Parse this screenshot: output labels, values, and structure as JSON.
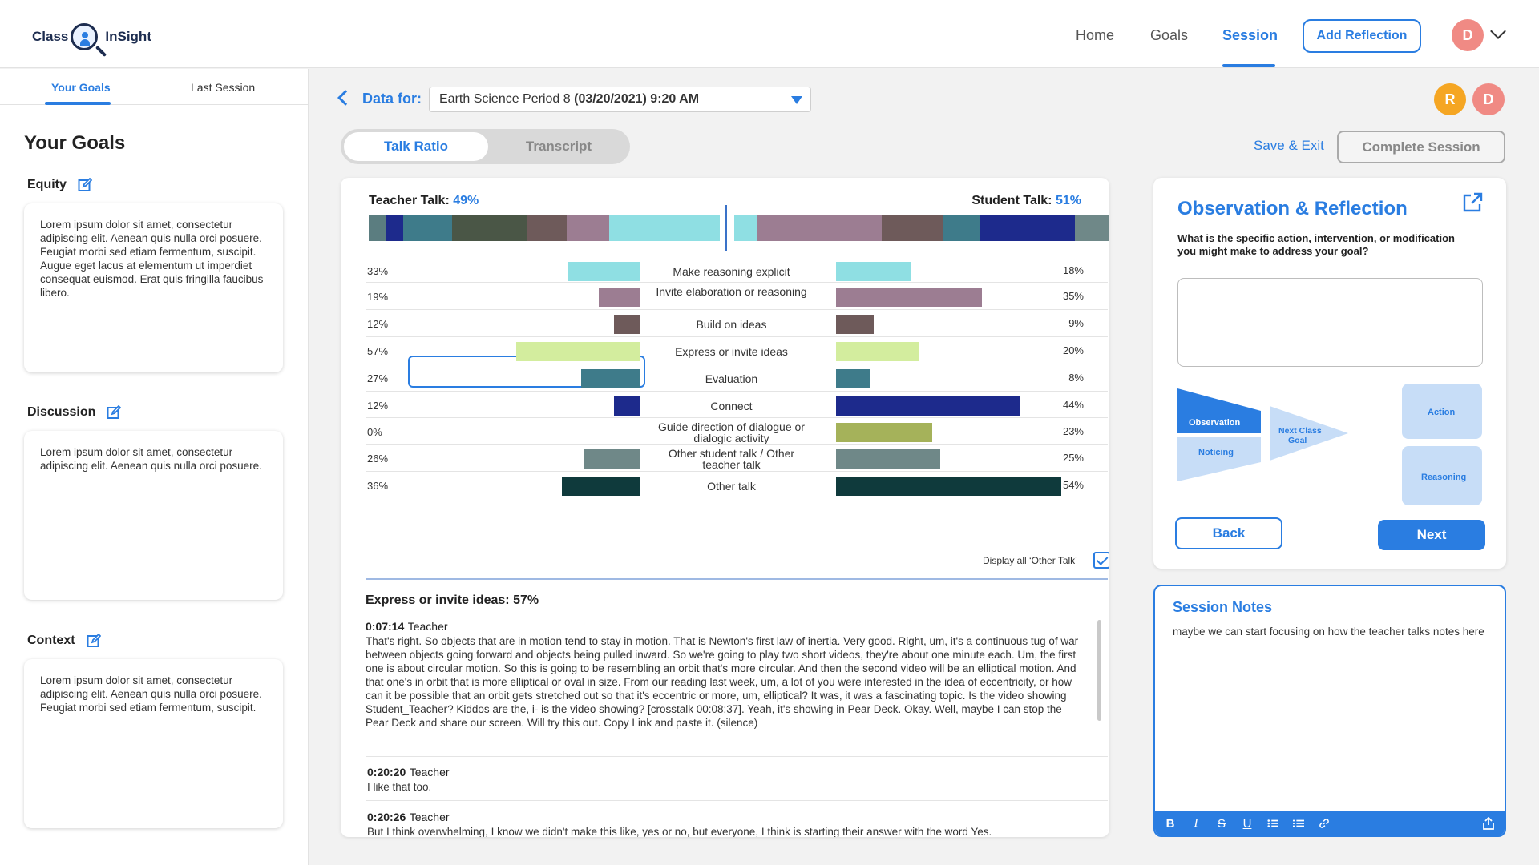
{
  "header": {
    "logo_left": "Class",
    "logo_right": "InSight",
    "nav": [
      {
        "label": "Home"
      },
      {
        "label": "Goals"
      },
      {
        "label": "Session"
      }
    ],
    "add_reflection": "Add Reflection",
    "user_initial": "D"
  },
  "sidebar": {
    "tabs": [
      {
        "label": "Your Goals"
      },
      {
        "label": "Last Session"
      }
    ],
    "title": "Your Goals",
    "goals": [
      {
        "label": "Equity",
        "text": "Lorem ipsum dolor sit amet, consectetur adipiscing elit. Aenean quis nulla orci posuere. Feugiat morbi sed etiam fermentum, suscipit. Augue eget lacus at elementum ut imperdiet consequat euismod. Erat quis fringilla faucibus libero."
      },
      {
        "label": "Discussion",
        "text": "Lorem ipsum dolor sit amet, consectetur adipiscing elit. Aenean quis nulla orci posuere."
      },
      {
        "label": "Context",
        "text": "Lorem ipsum dolor sit amet, consectetur adipiscing elit. Aenean quis nulla orci posuere. Feugiat morbi sed etiam fermentum, suscipit."
      }
    ]
  },
  "session": {
    "data_for_label": "Data for:",
    "select_name": "Earth Science Period 8",
    "select_date": "(03/20/2021) 9:20 AM",
    "participants": [
      {
        "initial": "R",
        "color": "#f5a623"
      },
      {
        "initial": "D",
        "color": "#f08a84"
      }
    ],
    "tabs": {
      "talk_ratio": "Talk Ratio",
      "transcript": "Transcript"
    },
    "save_exit": "Save & Exit",
    "complete": "Complete Session"
  },
  "talk": {
    "teacher_label": "Teacher Talk:",
    "teacher_pct": "49%",
    "student_label": "Student Talk:",
    "student_pct": "51%",
    "teacher_stack": [
      {
        "color": "#5b7d80",
        "value": 18
      },
      {
        "color": "#1d2a8c",
        "value": 17
      },
      {
        "color": "#3e7b8a",
        "value": 50
      },
      {
        "color": "#4a5646",
        "value": 76
      },
      {
        "color": "#6e5a5a",
        "value": 41
      },
      {
        "color": "#9c7d92",
        "value": 43
      },
      {
        "color": "#8fdfe3",
        "value": 113
      }
    ],
    "student_stack": [
      {
        "color": "#8fdfe3",
        "value": 28
      },
      {
        "color": "#9c7d92",
        "value": 155
      },
      {
        "color": "#6e5a5a",
        "value": 76
      },
      {
        "color": "#3e7b8a",
        "value": 46
      },
      {
        "color": "#1d2a8c",
        "value": 117
      },
      {
        "color": "#6f8888",
        "value": 42
      }
    ],
    "rows": [
      {
        "label": "Make reasoning explicit",
        "teacher": "33%",
        "student": "18%",
        "t": 33,
        "s": 18,
        "color": "#8fdfe3"
      },
      {
        "label": "Invite elaboration or reasoning",
        "teacher": "19%",
        "student": "35%",
        "t": 19,
        "s": 35,
        "color": "#9c7d92"
      },
      {
        "label": "Build on ideas",
        "teacher": "12%",
        "student": "9%",
        "t": 12,
        "s": 9,
        "color": "#6e5a5a"
      },
      {
        "label": "Express or invite ideas",
        "teacher": "57%",
        "student": "20%",
        "t": 57,
        "s": 20,
        "color": "#d3ed9e"
      },
      {
        "label": "Evaluation",
        "teacher": "27%",
        "student": "8%",
        "t": 27,
        "s": 8,
        "color": "#3e7b8a"
      },
      {
        "label": "Connect",
        "teacher": "12%",
        "student": "44%",
        "t": 12,
        "s": 44,
        "color": "#1d2a8c"
      },
      {
        "label": "Guide direction of dialogue or dialogic activity",
        "teacher": "0%",
        "student": "23%",
        "t": 0,
        "s": 23,
        "color": "#a5b25a"
      },
      {
        "label": "Other student talk / Other teacher talk",
        "teacher": "26%",
        "student": "25%",
        "t": 26,
        "s": 25,
        "color": "#6f8888"
      },
      {
        "label": "Other talk",
        "teacher": "36%",
        "student": "54%",
        "t": 36,
        "s": 54,
        "color": "#0f3a3c"
      }
    ],
    "display_other": "Display all ‘Other Talk’",
    "section_title": "Express or invite ideas: 57%",
    "transcript": [
      {
        "time": "0:07:14",
        "speaker": "Teacher",
        "text": "That's right. So objects that are in motion tend to stay in motion. That is Newton's first law of inertia. Very good. Right, um, it's a continuous tug of war between objects going forward and objects being pulled inward. So we're going to play two short videos, they're about one minute each. Um, the first one is about circular motion. So this is going to be resembling an orbit that's more circular. And then the second video will be an elliptical motion. And that one's in orbit that is more elliptical or oval in size. From our reading last week, um, a lot of you were interested in the idea of eccentricity, or how can it be possible that an orbit gets stretched out so that it's eccentric or more, um, elliptical? It was, it was a fascinating topic. Is the video showing Student_Teacher? Kiddos are the, i- is the video showing? [crosstalk 00:08:37]. Yeah, it's showing in Pear Deck. Okay. Well, maybe I can stop the Pear Deck and share our screen. Will try this out. Copy Link and paste it. (silence)"
      },
      {
        "time": "0:20:20",
        "speaker": "Teacher",
        "text": "I like that too."
      },
      {
        "time": "0:20:26",
        "speaker": "Teacher",
        "text": "But I think overwhelming, I know we didn't make this like, yes or no, but everyone, I think is starting their answer with the word Yes."
      }
    ]
  },
  "observation": {
    "title": "Observation & Reflection",
    "question": "What is the specific action, intervention, or modification you might make to address your goal?",
    "diagram": {
      "observation": "Observation",
      "noticing": "Noticing",
      "next_goal_line1": "Next Class",
      "next_goal_line2": "Goal",
      "action": "Action",
      "reasoning": "Reasoning"
    },
    "back": "Back",
    "next": "Next"
  },
  "notes": {
    "title": "Session Notes",
    "text": "maybe we can start focusing on how the teacher talks notes here",
    "toolbar": {
      "bold": "B",
      "italic": "I",
      "strike": "S",
      "underline": "U"
    }
  }
}
